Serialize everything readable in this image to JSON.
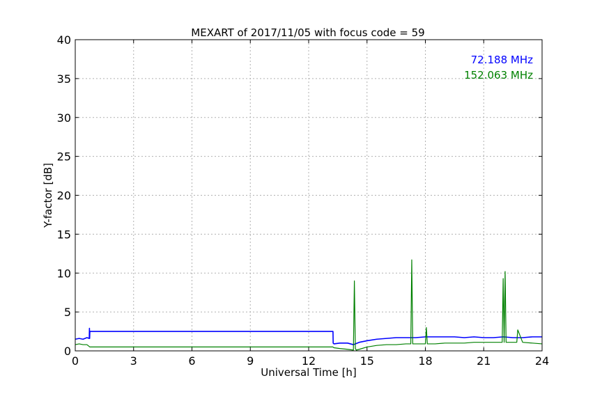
{
  "chart_data": {
    "type": "line",
    "title": "MEXART of 2017/11/05 with focus code = 59",
    "xlabel": "Universal Time [h]",
    "ylabel": "Y-factor [dB]",
    "xlim": [
      0,
      24
    ],
    "ylim": [
      0,
      40
    ],
    "xticks": [
      0,
      3,
      6,
      9,
      12,
      15,
      18,
      21,
      24
    ],
    "yticks": [
      0,
      5,
      10,
      15,
      20,
      25,
      30,
      35,
      40
    ],
    "grid": true,
    "legend_placement": "top-right",
    "series": [
      {
        "name": "72.188 MHz",
        "color": "#0000ff",
        "x": [
          0,
          0.2,
          0.4,
          0.6,
          0.72,
          0.73,
          0.74,
          0.75,
          13.25,
          13.26,
          13.3,
          13.6,
          14.0,
          14.3,
          14.6,
          15.0,
          15.5,
          16.0,
          16.5,
          17.0,
          17.5,
          18.0,
          18.5,
          19.0,
          19.5,
          20.0,
          20.5,
          21.0,
          21.5,
          22.0,
          22.5,
          23.0,
          23.5,
          24.0
        ],
        "y": [
          1.5,
          1.6,
          1.5,
          1.7,
          1.6,
          2.9,
          1.6,
          2.5,
          2.5,
          1.0,
          0.9,
          1.0,
          1.0,
          0.8,
          1.1,
          1.3,
          1.5,
          1.6,
          1.7,
          1.7,
          1.7,
          1.8,
          1.8,
          1.8,
          1.8,
          1.7,
          1.8,
          1.7,
          1.7,
          1.8,
          1.7,
          1.7,
          1.8,
          1.8
        ]
      },
      {
        "name": "152.063 MHz",
        "color": "#008000",
        "x": [
          0,
          0.2,
          0.4,
          0.6,
          0.75,
          13.25,
          13.3,
          13.6,
          14.0,
          14.3,
          14.35,
          14.4,
          14.45,
          14.6,
          15.0,
          15.5,
          16.0,
          16.5,
          17.0,
          17.25,
          17.3,
          17.35,
          17.5,
          18.0,
          18.05,
          18.1,
          18.5,
          19.0,
          19.5,
          20.0,
          20.5,
          21.0,
          21.5,
          21.95,
          22.0,
          22.05,
          22.1,
          22.15,
          22.5,
          22.7,
          22.75,
          23.0,
          23.5,
          24.0
        ],
        "y": [
          0.8,
          0.9,
          0.8,
          0.8,
          0.5,
          0.5,
          0.4,
          0.3,
          0.2,
          0.1,
          9.0,
          0.3,
          0.1,
          0.2,
          0.5,
          0.7,
          0.8,
          0.8,
          0.9,
          0.9,
          11.7,
          0.9,
          0.9,
          0.9,
          3.0,
          0.9,
          0.9,
          1.0,
          1.0,
          1.0,
          1.1,
          1.1,
          1.1,
          1.1,
          9.3,
          1.1,
          10.2,
          1.1,
          1.1,
          1.1,
          2.7,
          1.1,
          1.0,
          0.9
        ]
      }
    ]
  }
}
